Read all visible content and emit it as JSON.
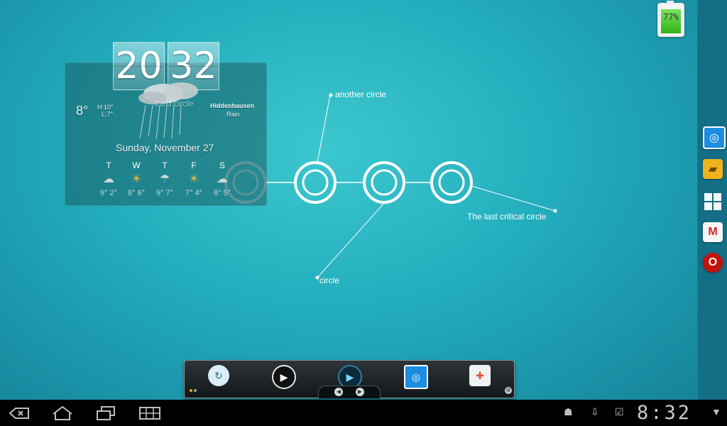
{
  "weather": {
    "hour": "20",
    "minute": "32",
    "current_temp": "8°",
    "high": "H:10°",
    "low": "L:7°",
    "city": "Hiddenhausen",
    "condition": "Rain",
    "date": "Sunday, November 27",
    "overlay_label": "third circle",
    "forecast": [
      {
        "day": "T",
        "temps": "9° 2°",
        "icon": "cloudy-icon"
      },
      {
        "day": "W",
        "temps": "8° 6°",
        "icon": "sun-cloud-icon"
      },
      {
        "day": "T",
        "temps": "9° 7°",
        "icon": "rain-icon"
      },
      {
        "day": "F",
        "temps": "7° 4°",
        "icon": "sun-rain-icon"
      },
      {
        "day": "S",
        "temps": "8° 5°",
        "icon": "cloudy-icon"
      }
    ]
  },
  "annotations": {
    "another": "another circle",
    "circle": "circle",
    "last": "The last critical circle"
  },
  "battery": {
    "level_text": "77%",
    "level": 0.77
  },
  "dock": {
    "icons": [
      "quickoffice-icon",
      "file-manager-icon",
      "app-grid-icon",
      "gmail-icon",
      "opera-icon"
    ]
  },
  "launcher": {
    "icons": [
      "refresh-app-icon",
      "media-player-icon",
      "video-player-icon",
      "quickoffice-icon",
      "puzzle-app-icon"
    ]
  },
  "system_bar": {
    "time": "8:32",
    "icons": [
      "back-icon",
      "home-icon",
      "recent-apps-icon",
      "menu-grid-icon",
      "android-icon",
      "download-icon",
      "task-icon",
      "signal-icon"
    ]
  },
  "colors": {
    "wallpaper": "#23aebd",
    "dock": "#136e86",
    "system_bar": "#000000"
  }
}
